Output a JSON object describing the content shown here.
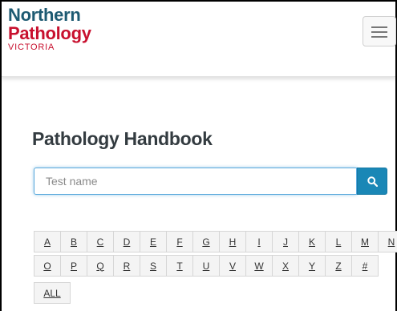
{
  "header": {
    "logo": {
      "line1": "Northern",
      "line2": "Pathology",
      "line3": "VICTORIA"
    },
    "menu_icon": "hamburger-icon"
  },
  "main": {
    "title": "Pathology Handbook",
    "search": {
      "placeholder": "Test name",
      "value": "",
      "button_icon": "search-icon"
    },
    "alphabet": {
      "row1": [
        "A",
        "B",
        "C",
        "D",
        "E",
        "F",
        "G",
        "H",
        "I",
        "J",
        "K",
        "L",
        "M",
        "N"
      ],
      "row2": [
        "O",
        "P",
        "Q",
        "R",
        "S",
        "T",
        "U",
        "V",
        "W",
        "X",
        "Y",
        "Z",
        "#"
      ],
      "row3": [
        "ALL"
      ]
    }
  },
  "colors": {
    "logo_blue": "#1d5a72",
    "logo_red": "#c8102e",
    "search_button": "#1a87b6",
    "input_focus_border": "#5aa9dc"
  }
}
